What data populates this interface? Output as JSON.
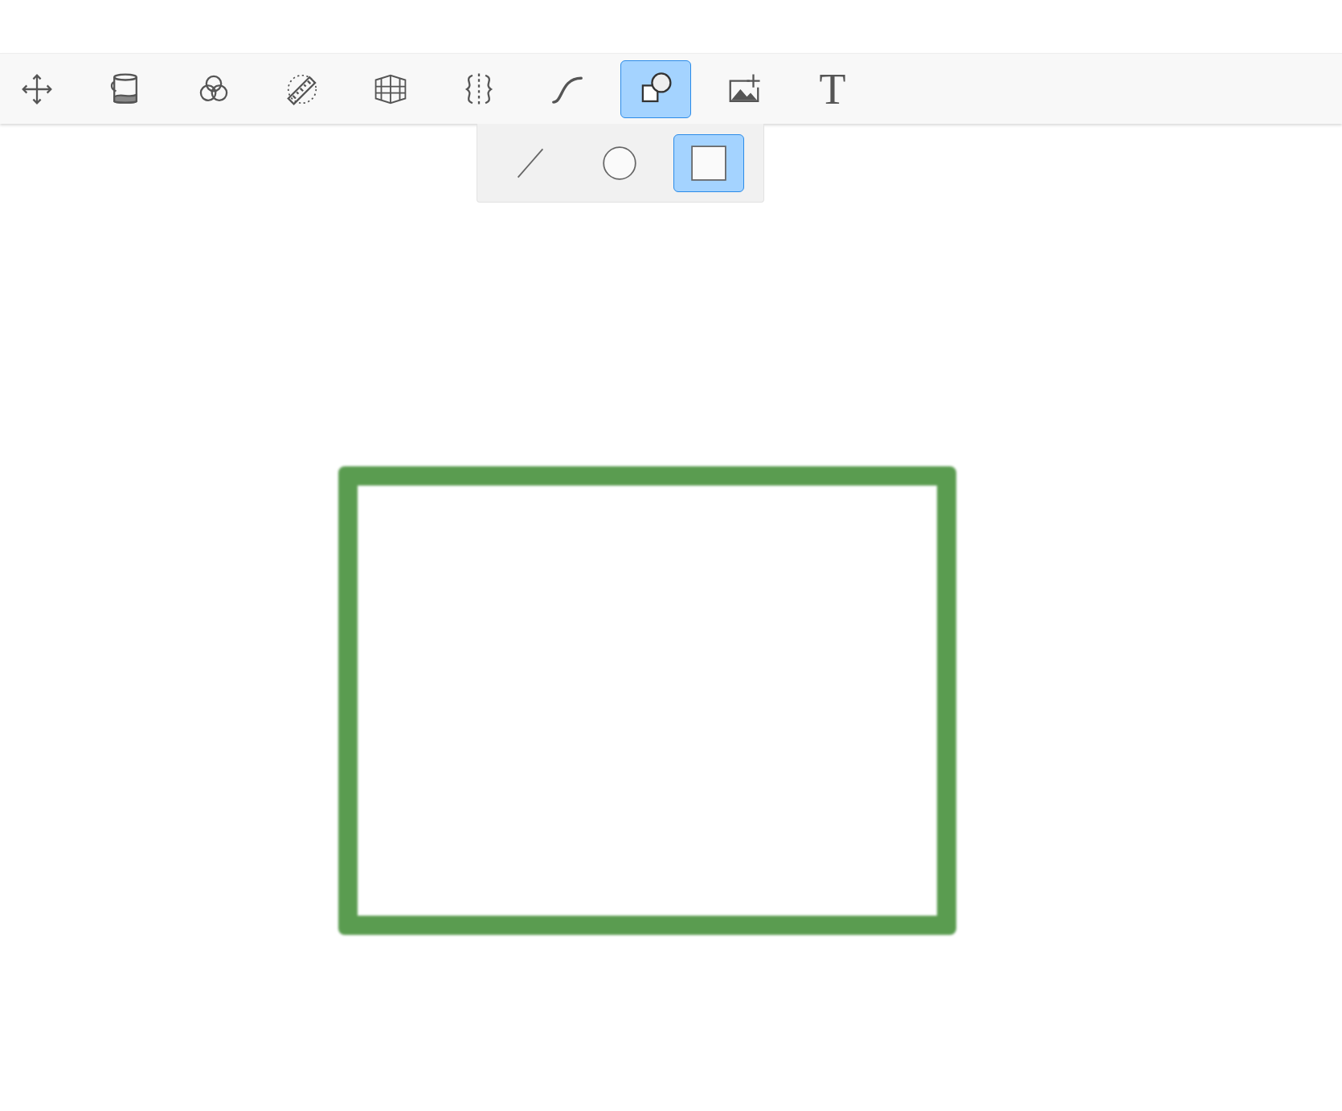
{
  "toolbar": {
    "tools": [
      {
        "kind": "move",
        "selected": false
      },
      {
        "kind": "fill",
        "selected": false
      },
      {
        "kind": "color",
        "selected": false
      },
      {
        "kind": "ruler",
        "selected": false
      },
      {
        "kind": "perspective",
        "selected": false
      },
      {
        "kind": "symmetry",
        "selected": false
      },
      {
        "kind": "curve",
        "selected": false
      },
      {
        "kind": "shapes",
        "selected": true
      },
      {
        "kind": "image",
        "selected": false
      },
      {
        "kind": "text",
        "glyph": "T",
        "selected": false
      }
    ]
  },
  "shape_menu": {
    "items": [
      {
        "kind": "line",
        "selected": false
      },
      {
        "kind": "ellipse",
        "selected": false
      },
      {
        "kind": "rectangle",
        "selected": true
      }
    ]
  }
}
